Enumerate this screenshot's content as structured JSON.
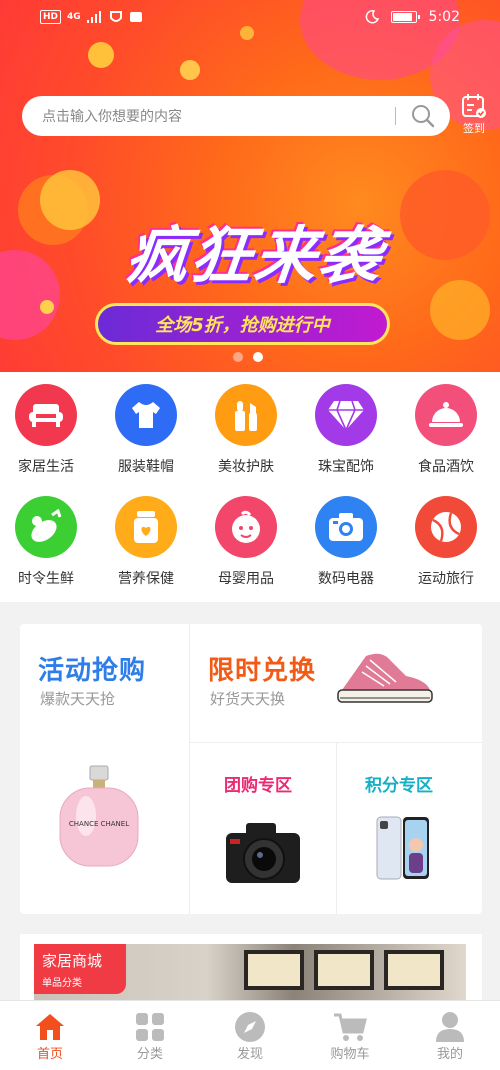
{
  "status_bar": {
    "time": "5:02",
    "network_chip": "HD",
    "network_type": "4G"
  },
  "search": {
    "placeholder": "点击输入你想要的内容"
  },
  "signin": {
    "label": "签到"
  },
  "banner": {
    "title": "疯狂来袭",
    "subtitle": "全场5折，抢购进行中",
    "slide_count": 2,
    "active_slide": 2
  },
  "categories": [
    {
      "label": "家居生活",
      "icon": "sofa-icon",
      "color": "#f2384e"
    },
    {
      "label": "服装鞋帽",
      "icon": "tshirt-icon",
      "color": "#2f6cf5"
    },
    {
      "label": "美妆护肤",
      "icon": "cosmetics-icon",
      "color": "#ff9c12"
    },
    {
      "label": "珠宝配饰",
      "icon": "diamond-icon",
      "color": "#a33ae8"
    },
    {
      "label": "食品酒饮",
      "icon": "food-cloche-icon",
      "color": "#f2507a"
    },
    {
      "label": "时令生鲜",
      "icon": "vegetable-icon",
      "color": "#3ccf33"
    },
    {
      "label": "营养保健",
      "icon": "supplement-jar-icon",
      "color": "#ffab1a"
    },
    {
      "label": "母婴用品",
      "icon": "baby-face-icon",
      "color": "#f2466a"
    },
    {
      "label": "数码电器",
      "icon": "camera-icon",
      "color": "#2f82f2"
    },
    {
      "label": "运动旅行",
      "icon": "ball-icon",
      "color": "#f24a38"
    }
  ],
  "promo": {
    "flash_sale": {
      "title": "活动抢购",
      "subtitle": "爆款天天抢"
    },
    "limited_exchange": {
      "title": "限时兑换",
      "subtitle": "好货天天换"
    },
    "group_buy": {
      "title": "团购专区"
    },
    "points": {
      "title": "积分专区"
    },
    "product_text": {
      "perfume": "CHANCE CHANEL"
    }
  },
  "mall": {
    "title": "家居商城",
    "subtitle": "单品分类"
  },
  "tabs": [
    {
      "label": "首页",
      "icon": "home-icon",
      "active": true
    },
    {
      "label": "分类",
      "icon": "grid-icon",
      "active": false
    },
    {
      "label": "发现",
      "icon": "compass-icon",
      "active": false
    },
    {
      "label": "购物车",
      "icon": "cart-icon",
      "active": false
    },
    {
      "label": "我的",
      "icon": "user-icon",
      "active": false
    }
  ],
  "colors": {
    "accent": "#f24e1e",
    "hero": "#ff5a24"
  }
}
